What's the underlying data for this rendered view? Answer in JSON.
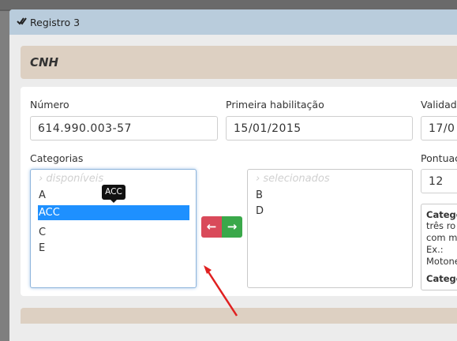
{
  "modal": {
    "title": "Registro 3",
    "section_title": "CNH"
  },
  "form": {
    "numero_label": "Número",
    "numero_value": "614.990.003-57",
    "primeira_habilitacao_label": "Primeira habilitação",
    "primeira_habilitacao_value": "15/01/2015",
    "validade_label": "Validad",
    "validade_value": "17/0",
    "categorias_label": "Categorias",
    "pontuacao_label": "Pontuaç",
    "pontuacao_value": "12"
  },
  "available_list": {
    "placeholder": "› disponíveis",
    "items": [
      "A",
      "ACC",
      "C",
      "E"
    ],
    "selected": "ACC",
    "tooltip": "ACC"
  },
  "selected_list": {
    "placeholder": "› selecionados",
    "items": [
      "B",
      "D"
    ]
  },
  "buttons": {
    "move_left_glyph": "←",
    "move_right_glyph": "→"
  },
  "info_box": {
    "lines": [
      "Catego",
      "três ro",
      "com m",
      "Ex.:",
      "Motone",
      "Catego"
    ]
  },
  "colors": {
    "header": "#b9ccdc",
    "section": "#ddd0c2",
    "selected_item": "#1e90ff",
    "btn_left": "#d94a5a",
    "btn_right": "#3aa84a",
    "annotation_arrow": "#e02020"
  }
}
